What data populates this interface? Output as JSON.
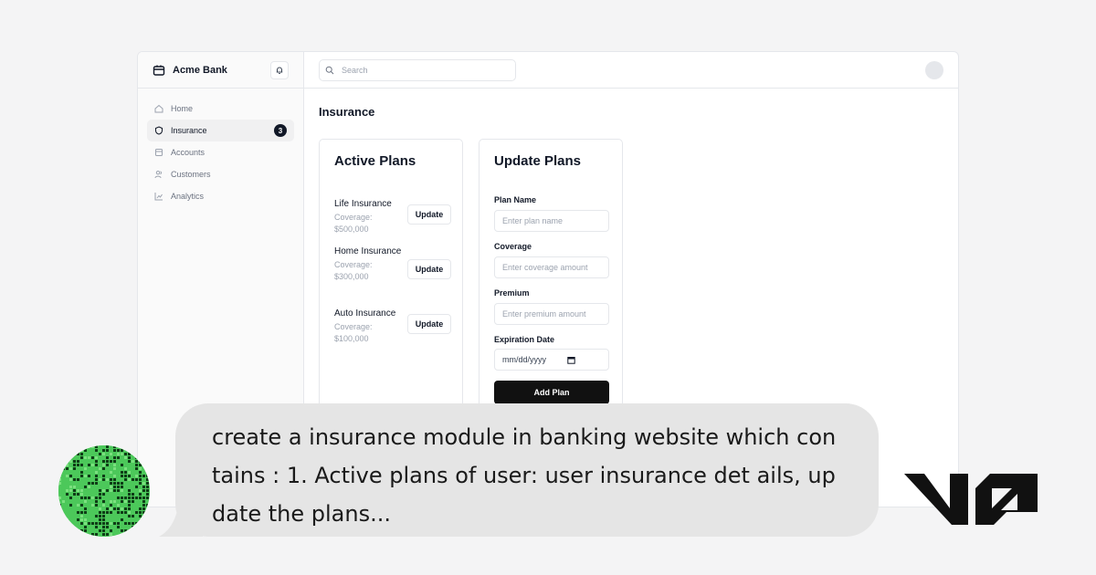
{
  "sidebar": {
    "brand": "Acme Bank",
    "items": [
      {
        "label": "Home",
        "icon": "home-icon",
        "active": false
      },
      {
        "label": "Insurance",
        "icon": "shield-icon",
        "active": true,
        "badge": "3"
      },
      {
        "label": "Accounts",
        "icon": "accounts-icon",
        "active": false
      },
      {
        "label": "Customers",
        "icon": "users-icon",
        "active": false
      },
      {
        "label": "Analytics",
        "icon": "chart-icon",
        "active": false
      }
    ]
  },
  "topbar": {
    "search_placeholder": "Search"
  },
  "main": {
    "title": "Insurance",
    "active_plans": {
      "title": "Active Plans",
      "update_label": "Update",
      "plans": [
        {
          "name": "Life Insurance",
          "coverage": "Coverage: $500,000"
        },
        {
          "name": "Home Insurance",
          "coverage": "Coverage: $300,000"
        },
        {
          "name": "Auto Insurance",
          "coverage": "Coverage: $100,000"
        }
      ]
    },
    "update_plans": {
      "title": "Update Plans",
      "fields": {
        "plan_name": {
          "label": "Plan Name",
          "placeholder": "Enter plan name"
        },
        "coverage": {
          "label": "Coverage",
          "placeholder": "Enter coverage amount"
        },
        "premium": {
          "label": "Premium",
          "placeholder": "Enter premium amount"
        },
        "expiration": {
          "label": "Expiration Date",
          "placeholder": "mm/dd/yyyy"
        }
      },
      "submit_label": "Add Plan"
    }
  },
  "chat": {
    "message": "create a insurance module in banking website which contains : 1. Active plans of user: user insurance det ails, update the plans..."
  },
  "colors": {
    "accent": "#111111",
    "avatar_green": "#4cc85a",
    "bubble": "#e5e5e5"
  }
}
